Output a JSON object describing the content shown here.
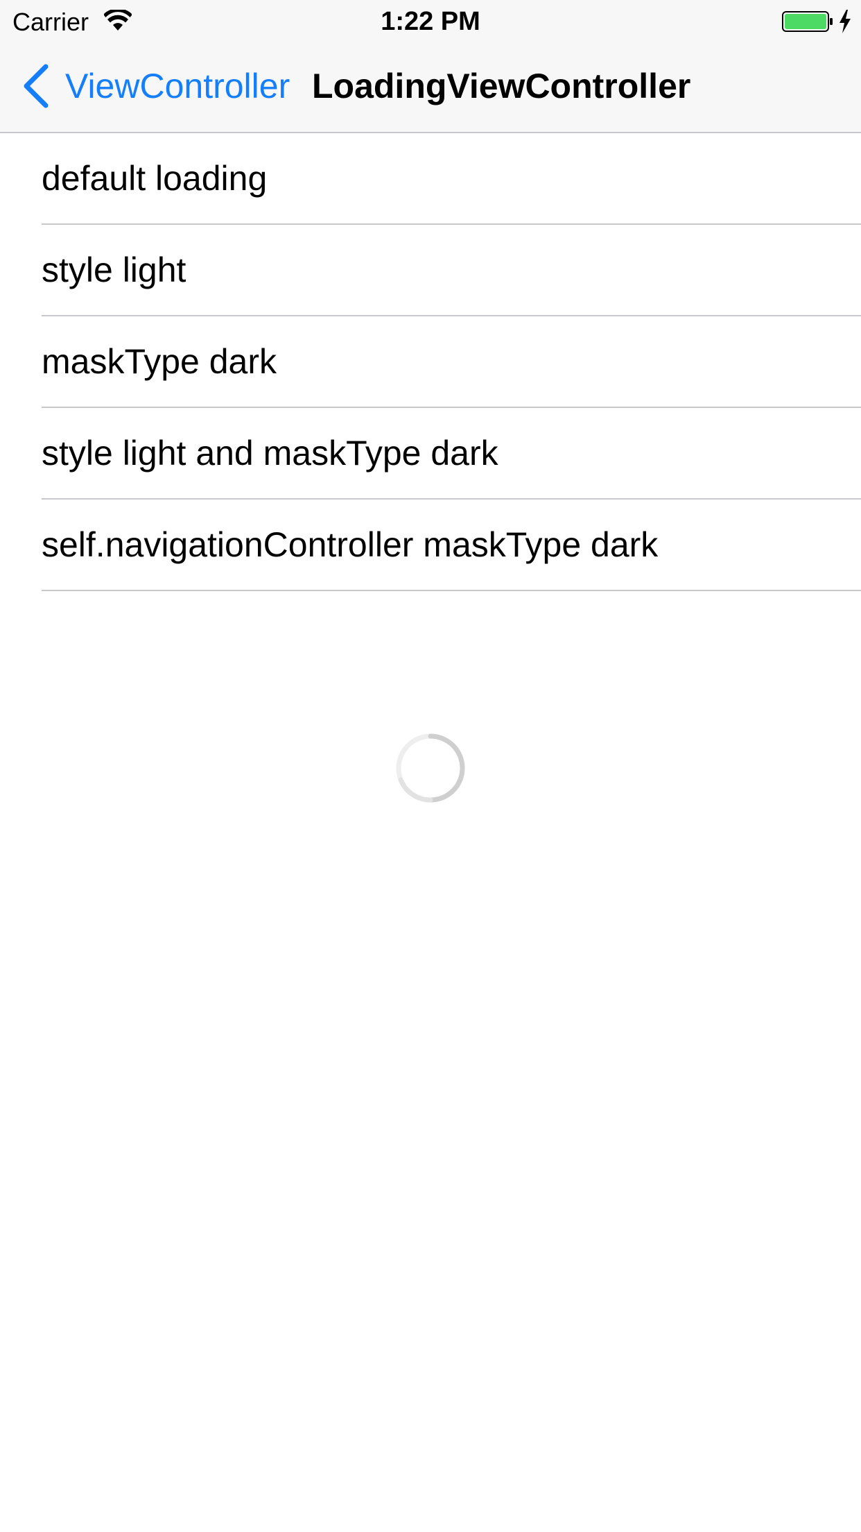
{
  "status_bar": {
    "carrier": "Carrier",
    "time": "1:22 PM",
    "battery_color": "#4cd964",
    "icons": [
      "wifi-icon",
      "battery-icon",
      "charging-bolt-icon"
    ]
  },
  "nav_bar": {
    "back_label": "ViewController",
    "title": "LoadingViewController",
    "accent_color": "#147efb",
    "back_icon": "chevron-left-icon"
  },
  "list": {
    "items": [
      {
        "label": "default loading"
      },
      {
        "label": "style light"
      },
      {
        "label": "maskType dark"
      },
      {
        "label": "style light and maskType dark"
      },
      {
        "label": "self.navigationController maskType dark"
      }
    ]
  },
  "loading": {
    "icon": "loading-spinner-icon"
  }
}
